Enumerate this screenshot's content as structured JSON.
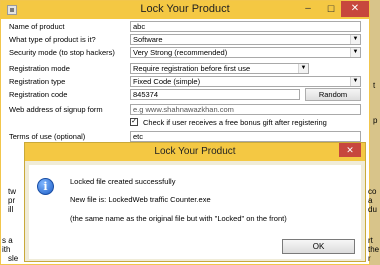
{
  "window": {
    "title": "Lock Your Product",
    "minimize": "–",
    "maximize": "☐",
    "close": "✕"
  },
  "form": {
    "name": {
      "label": "Name of product",
      "value": "abc"
    },
    "type": {
      "label": "What type of product is it?",
      "value": "Software"
    },
    "security": {
      "label": "Security mode (to stop hackers)",
      "value": "Very Strong (recommended)"
    },
    "reg_mode": {
      "label": "Registration mode",
      "value": "Require registration before first use"
    },
    "reg_type": {
      "label": "Registration type",
      "value": "Fixed Code (simple)"
    },
    "reg_code": {
      "label": "Registration code",
      "value": "845374",
      "button": "Random"
    },
    "web": {
      "label": "Web address of signup form",
      "placeholder": "e.g www.shahnawazkhan.com"
    },
    "check": {
      "label": "Check if user receives a free bonus gift after registering",
      "checked": true
    },
    "terms": {
      "label": "Terms of use (optional)",
      "value": "etc"
    }
  },
  "background_fragments": {
    "tw": "tw",
    "pr": "pr",
    "ill": "ill",
    "s_a": "s a",
    "ith": "ith",
    "sle": "sle",
    "co": "co",
    "a": "a",
    "du": "du",
    "rt": "rt",
    "the": "the",
    "r": "r",
    "t": "t",
    "p": "p"
  },
  "dialog": {
    "title": "Lock Your Product",
    "close": "✕",
    "icon_glyph": "i",
    "line1": "Locked file created successfully",
    "line2": "New file is: LockedWeb traffic Counter.exe",
    "line3": "(the same name as the original file but with \"Locked\" on the front)",
    "ok": "OK"
  },
  "colors": {
    "titlebar": "#f4c843",
    "close": "#c7473d",
    "desktop": "#d8c48a"
  }
}
